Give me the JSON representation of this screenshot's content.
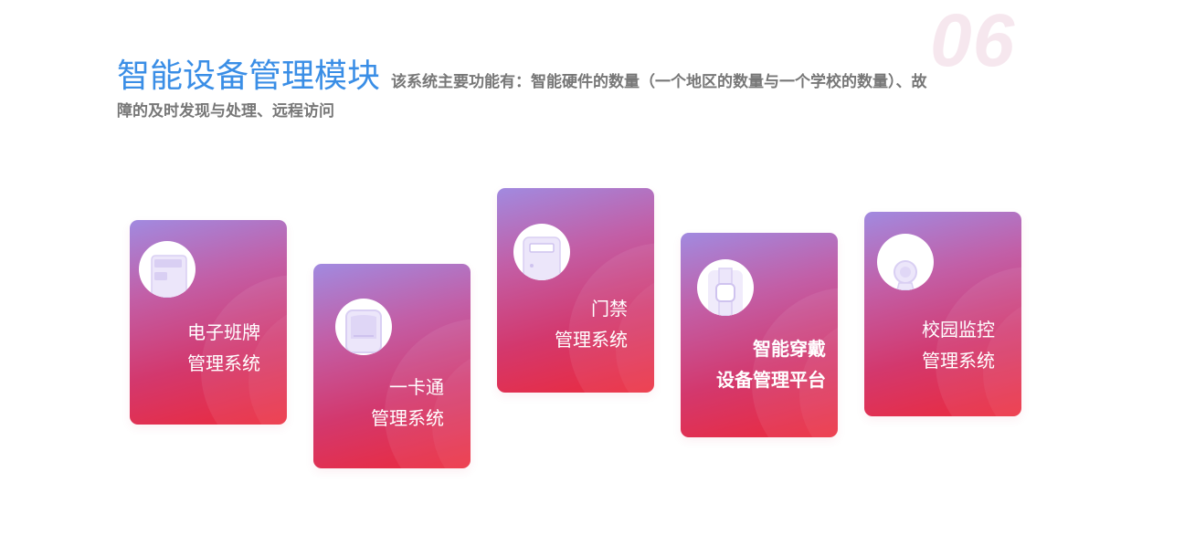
{
  "page_number": "06",
  "heading": {
    "title": "智能设备管理模块",
    "description_line1": "该系统主要功能有：智能硬件的数量（一个地区的数量与一个学校的数量）、故",
    "description_line2": "障的及时发现与处理、远程访问"
  },
  "cards": [
    {
      "icon": "class-board-icon",
      "line1": "电子班牌",
      "line2": "管理系统"
    },
    {
      "icon": "card-icon",
      "line1": "一卡通",
      "line2": "管理系统"
    },
    {
      "icon": "door-access-icon",
      "line1": "门禁",
      "line2": "管理系统"
    },
    {
      "icon": "wearable-watch-icon",
      "line1": "智能穿戴",
      "line2": "设备管理平台"
    },
    {
      "icon": "camera-icon",
      "line1": "校园监控",
      "line2": "管理系统"
    }
  ],
  "colors": {
    "title": "#3a8ee6",
    "card_gradient_top": "#a18ae0",
    "card_gradient_bottom": "#ec2a3b",
    "icon_tint": "#e4dcf6"
  }
}
